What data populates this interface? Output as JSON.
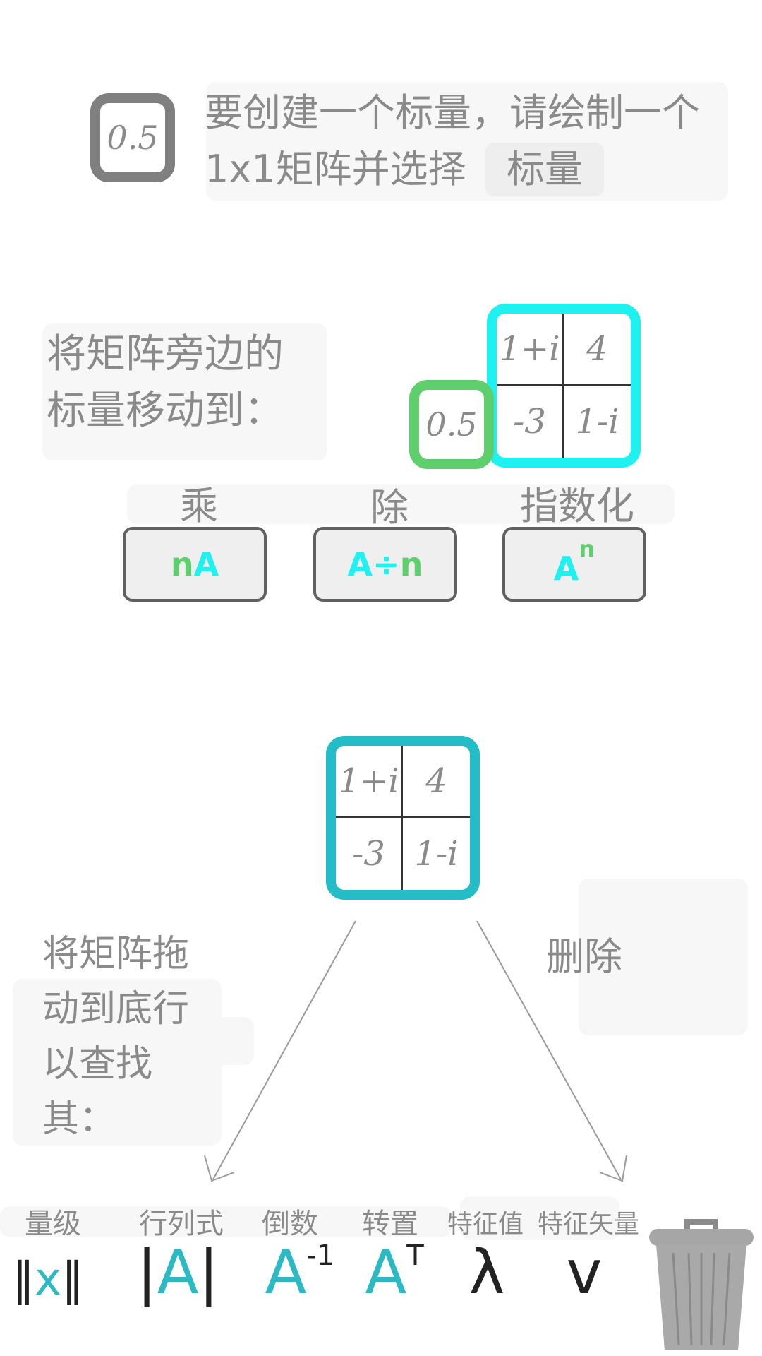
{
  "scalar_tip": {
    "icon_value": "0.5",
    "text": "要创建一个标量，请绘制一个1x1矩阵并选择",
    "button_label": "标量"
  },
  "scalar_ops_tip": {
    "text": "将矩阵旁边的标量移动到：",
    "scalar_value": "0.5",
    "matrix": [
      "1+i",
      "4",
      "-3",
      "1-i"
    ],
    "ops": [
      {
        "label": "乘",
        "symbol_a": "n",
        "symbol_b": "A"
      },
      {
        "label": "除",
        "symbol_a": "A÷",
        "symbol_b": "n"
      },
      {
        "label": "指数化",
        "symbol_a": "A",
        "symbol_b": "n"
      }
    ]
  },
  "drag_tip": {
    "matrix": [
      "1+i",
      "4",
      "-3",
      "1-i"
    ],
    "text": "将矩阵拖动到底行以查找其：",
    "delete_label": "删除"
  },
  "toolbar": {
    "items": [
      {
        "label": "量级",
        "symbol_outer": "‖",
        "symbol_inner": "x"
      },
      {
        "label": "行列式",
        "symbol_outer": "|",
        "symbol_inner": "A"
      },
      {
        "label": "倒数",
        "symbol_base": "A",
        "symbol_sup": "-1"
      },
      {
        "label": "转置",
        "symbol_base": "A",
        "symbol_sup": "T"
      },
      {
        "label": "特征值",
        "symbol": "λ"
      },
      {
        "label": "特征矢量",
        "symbol": "v"
      }
    ]
  },
  "colors": {
    "cyan": "#1ff0f0",
    "green": "#5fcf6e",
    "teal": "#2bbac3",
    "gray": "#8a8a8a"
  }
}
